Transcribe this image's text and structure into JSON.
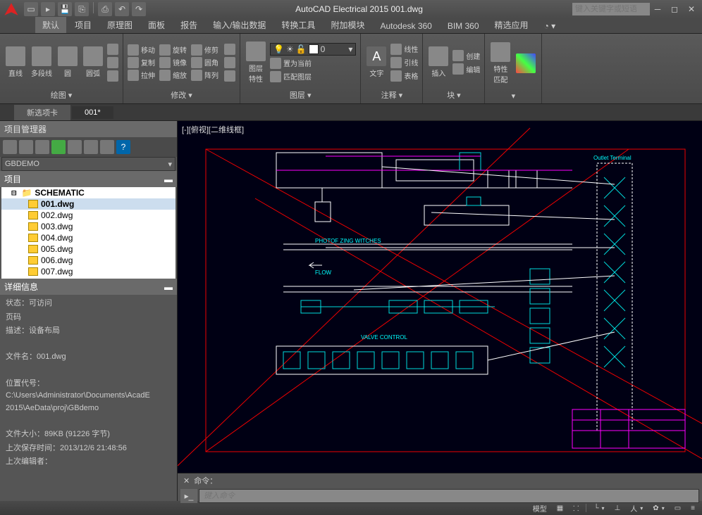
{
  "title": "AutoCAD Electrical 2015    001.dwg",
  "search_placeholder": "键入关键字或短语",
  "ribbon_tabs": [
    "默认",
    "项目",
    "原理图",
    "面板",
    "报告",
    "输入/输出数据",
    "转换工具",
    "附加模块",
    "Autodesk 360",
    "BIM 360",
    "精选应用"
  ],
  "ribbon_active": 0,
  "draw_panel": {
    "title": "绘图 ▾",
    "items": [
      "直线",
      "多段线",
      "圆",
      "圆弧"
    ]
  },
  "modify_panel": {
    "title": "修改 ▾",
    "rows": [
      [
        "移动",
        "旋转",
        "修剪"
      ],
      [
        "复制",
        "镜像",
        "圆角"
      ],
      [
        "拉伸",
        "缩放",
        "阵列"
      ]
    ]
  },
  "layer_panel": {
    "title": "图层 ▾",
    "big": "图层\n特性",
    "cur": "0",
    "setcurrent": "置为当前",
    "match": "匹配图层"
  },
  "annot_panel": {
    "title": "注释 ▾",
    "big": "文字",
    "rows": [
      "线性",
      "引线",
      "表格"
    ]
  },
  "block_panel": {
    "title": "块 ▾",
    "big": "插入",
    "rows": [
      "创建",
      "编辑"
    ]
  },
  "prop_panel": {
    "title": "特性\n匹配"
  },
  "doctabs": [
    "新选项卡",
    "001*"
  ],
  "doctab_active": 1,
  "pm": {
    "title": "项目管理器",
    "combo": "GBDEMO",
    "project": "项目",
    "root": "SCHEMATIC",
    "files": [
      "001.dwg",
      "002.dwg",
      "003.dwg",
      "004.dwg",
      "005.dwg",
      "006.dwg",
      "007.dwg"
    ],
    "selected": 0
  },
  "details": {
    "title": "详细信息",
    "status_lbl": "状态：",
    "status": "可访问",
    "page_lbl": "页码",
    "desc_lbl": "描述：",
    "desc": "设备布局",
    "fname_lbl": "文件名：",
    "fname": "001.dwg",
    "loc_lbl": "位置代号：",
    "loc": "C:\\Users\\Administrator\\Documents\\AcadE 2015\\AeData\\proj\\GBdemo",
    "size_lbl": "文件大小：",
    "size": "89KB (91226 字节)",
    "saved_lbl": "上次保存时间：",
    "saved": "2013/12/6 21:48:56",
    "editor_lbl": "上次编辑者："
  },
  "viewport": "[-][俯视][二维线框]",
  "drawing_labels": {
    "outlet": "Outlet Terminal",
    "flow": "FLOW",
    "valve": "VALVE CONTROL",
    "photo": "PHOTOF  ZING  WITCHES"
  },
  "cmd_label": "命令：",
  "cmd_placeholder": "键入命令",
  "status": {
    "model": "模型"
  }
}
